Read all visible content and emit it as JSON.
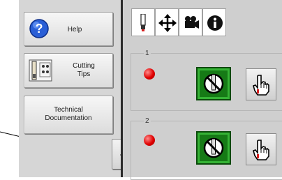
{
  "sidebar": {
    "help_label": "Help",
    "cutting_tips_label": "Cutting\nTips",
    "technical_doc_label": "Technical\nDocumentation"
  },
  "tabs": [
    {
      "icon": "torch-icon"
    },
    {
      "icon": "move-arrows-icon"
    },
    {
      "icon": "camera-icon"
    },
    {
      "icon": "info-icon"
    }
  ],
  "groups": [
    {
      "label": "1",
      "status_color": "#e00000"
    },
    {
      "label": "2",
      "status_color": "#e00000"
    }
  ],
  "colors": {
    "sidebar_bg": "#d6d6d6",
    "panel_bg": "#cfcfcf",
    "green_button": "#167a16",
    "led_red": "#e00000",
    "help_icon_blue": "#2a5fd6"
  }
}
